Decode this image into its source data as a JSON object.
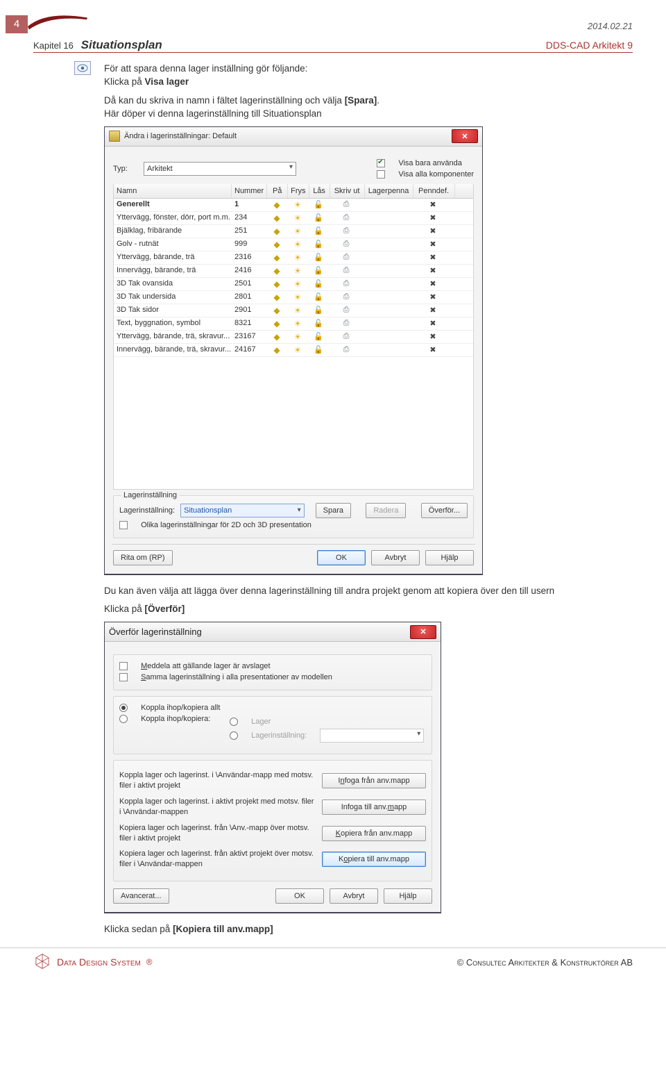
{
  "header": {
    "page_number": "4",
    "date": "2014.02.21",
    "chapter": "Kapitel 16",
    "title": "Situationsplan",
    "product": "DDS-CAD Arkitekt 9"
  },
  "intro": {
    "p1a": "För att spara denna lager inställning gör följande:",
    "p1b_prefix": "Klicka på ",
    "p1b_bold": "Visa lager",
    "p2_prefix": "Då kan du skriva in namn i fältet lagerinställning och välja ",
    "p2_bold": "[Spara]",
    "p2_suffix": ".",
    "p3": "Här döper vi denna lagerinställning till Situationsplan"
  },
  "dlg1": {
    "title": "Ändra i lagerinställningar: Default",
    "typ_label": "Typ:",
    "typ_value": "Arkitekt",
    "chk1": "Visa bara använda",
    "chk2": "Visa alla komponenter",
    "cols": {
      "name": "Namn",
      "num": "Nummer",
      "on": "På",
      "fr": "Frys",
      "lk": "Lås",
      "pr": "Skriv ut",
      "pen": "Lagerpenna",
      "pd": "Penndef."
    },
    "rows": [
      {
        "name": "Generellt",
        "num": "1",
        "bold": true
      },
      {
        "name": "Yttervägg, fönster, dörr, port m.m.",
        "num": "234"
      },
      {
        "name": "Bjälklag, fribärande",
        "num": "251"
      },
      {
        "name": "Golv - rutnät",
        "num": "999"
      },
      {
        "name": "Yttervägg, bärande, trä",
        "num": "2316"
      },
      {
        "name": "Innervägg, bärande, trä",
        "num": "2416"
      },
      {
        "name": "3D Tak ovansida",
        "num": "2501"
      },
      {
        "name": "3D Tak undersida",
        "num": "2801"
      },
      {
        "name": "3D Tak sidor",
        "num": "2901"
      },
      {
        "name": "Text, byggnation, symbol",
        "num": "8321"
      },
      {
        "name": "Yttervägg, bärande, trä, skravur...",
        "num": "23167"
      },
      {
        "name": "Innervägg, bärande, trä, skravur...",
        "num": "24167"
      }
    ],
    "group_title": "Lagerinställning",
    "ls_label": "Lagerinställning:",
    "ls_value": "Situationsplan",
    "btn_save": "Spara",
    "btn_delete": "Radera",
    "btn_transfer": "Överför...",
    "chk3": "Olika lagerinställningar för 2D och 3D presentation",
    "btn_rita": "Rita om (RP)",
    "btn_ok": "OK",
    "btn_cancel": "Avbryt",
    "btn_help": "Hjälp"
  },
  "mid": {
    "p1": "Du kan även välja att lägga över denna lagerinställning till andra projekt genom att kopiera över den till usern",
    "p2_prefix": "Klicka på ",
    "p2_bold": "[Överför]"
  },
  "dlg2": {
    "title": "Överför lagerinställning",
    "chk1": "Meddela att gällande lager är avslaget",
    "chk1_key": "M",
    "chk2": "Samma lagerinställning i alla presentationer av modellen",
    "chk2_key": "S",
    "r1": "Koppla ihop/kopiera allt",
    "r2": "Koppla ihop/kopiera:",
    "r2a": "Lager",
    "r2b": "Lagerinställning:",
    "op1": "Koppla lager och lagerinst. i \\Användar-mapp med motsv. filer i aktivt projekt",
    "op1_btn": "Infoga från anv.mapp",
    "op1_btn_key": "n",
    "op2": "Koppla lager och lagerinst. i aktivt projekt med motsv. filer i \\Användar-mappen",
    "op2_btn": "Infoga till anv.mapp",
    "op2_btn_key": "m",
    "op3": "Kopiera lager och lagerinst. från \\Anv.-mapp över motsv. filer i aktivt projekt",
    "op3_btn": "Kopiera från anv.mapp",
    "op3_btn_key": "K",
    "op4": "Kopiera lager och lagerinst. från aktivt projekt över motsv. filer i \\Användar-mappen",
    "op4_btn": "Kopiera till anv.mapp",
    "op4_btn_key": "o",
    "btn_adv": "Avancerat...",
    "btn_ok": "OK",
    "btn_cancel": "Avbryt",
    "btn_help": "Hjälp"
  },
  "post": {
    "p_prefix": "Klicka sedan på ",
    "p_bold": "[Kopiera till anv.mapp]"
  },
  "footer": {
    "brand": "Data Design System",
    "copyright": "© Consultec Arkitekter & Konstruktörer AB"
  }
}
